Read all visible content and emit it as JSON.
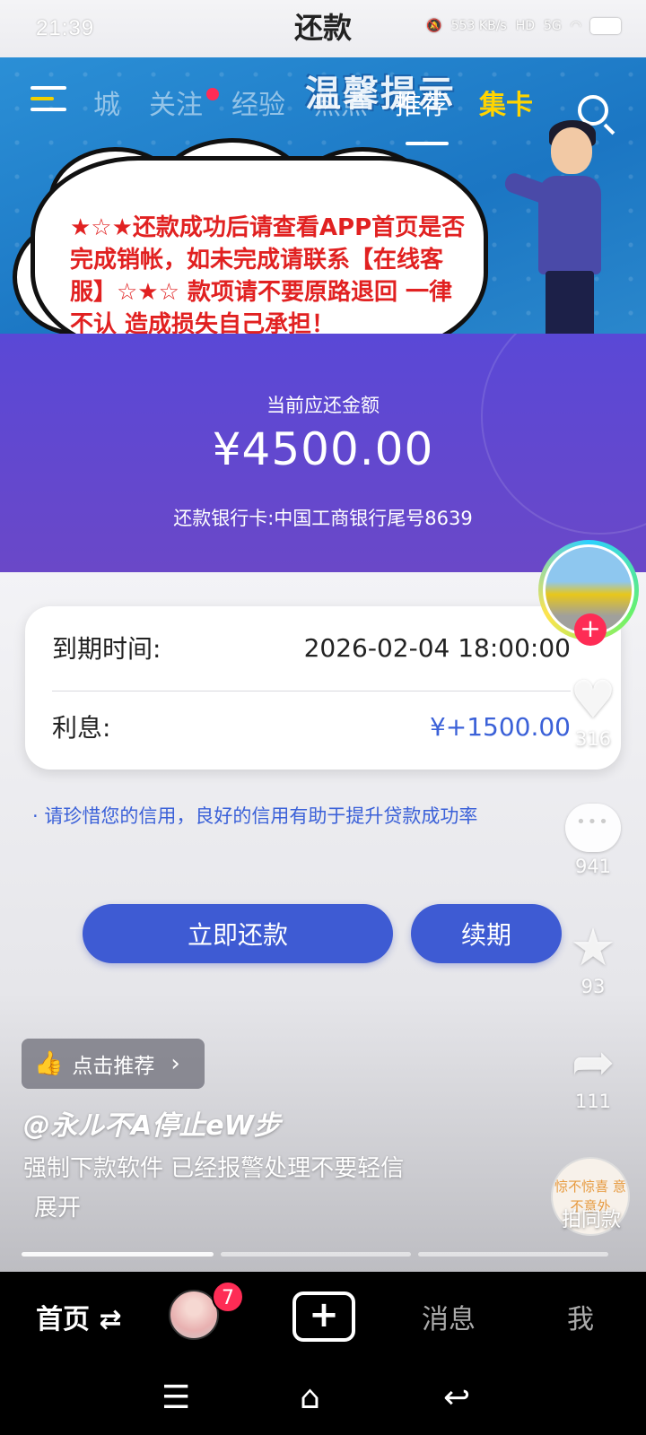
{
  "status_bar": {
    "time": "21:39",
    "net_speed": "553 KB/s",
    "hd": "HD",
    "signal": "5G"
  },
  "page_title": "还款",
  "banner": {
    "heading": "温馨提示",
    "nav_tabs": [
      "城",
      "关注",
      "经验",
      "热点",
      "推荐",
      "集卡"
    ],
    "notice": "★☆★还款成功后请查看APP首页是否完成销帐，如未完成请联系【在线客服】☆★☆ 款项请不要原路退回 一律不认 造成损失自己承担！"
  },
  "amount": {
    "label": "当前应还金额",
    "value": "¥4500.00",
    "bank_card": "还款银行卡:中国工商银行尾号8639"
  },
  "details": {
    "due_label": "到期时间:",
    "due_value": "2026-02-04 18:00:00",
    "interest_label": "利息:",
    "interest_value": "¥+1500.00"
  },
  "tip": "请珍惜您的信用，良好的信用有助于提升贷款成功率",
  "actions": {
    "repay": "立即还款",
    "renew": "续期"
  },
  "rail": {
    "likes": "316",
    "comments": "941",
    "favorites": "93",
    "shares": "111",
    "same_style": "拍同款",
    "same_style_disc": "惊不惊喜 意不意外"
  },
  "recommend": "点击推荐",
  "author": "@永ル不A停止eW步",
  "description": "强制下款软件   已经报警处理不要轻信",
  "expand": "展开",
  "bottom_nav": {
    "home": "首页",
    "badge": "7",
    "messages": "消息",
    "me": "我"
  },
  "colors": {
    "primary": "#3e5bd3",
    "header_purple": "#5a48d6",
    "warning_red": "#e12121"
  }
}
